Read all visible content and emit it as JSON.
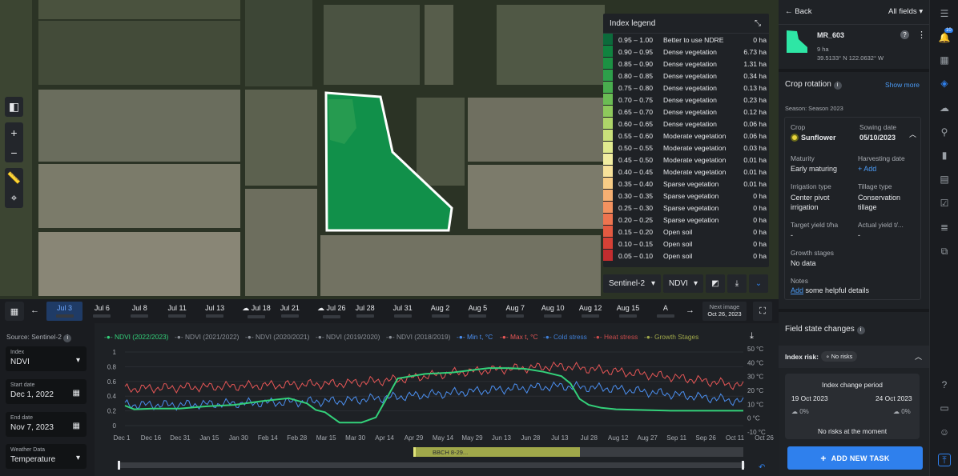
{
  "legend": {
    "title": "Index legend",
    "rows": [
      {
        "range": "0.95 – 1.00",
        "label": "Better to use NDRE",
        "area": "0 ha",
        "color": "#0c6b3b"
      },
      {
        "range": "0.90 – 0.95",
        "label": "Dense vegetation",
        "area": "6.73 ha",
        "color": "#10833f"
      },
      {
        "range": "0.85 – 0.90",
        "label": "Dense vegetation",
        "area": "1.31 ha",
        "color": "#1c9143"
      },
      {
        "range": "0.80 – 0.85",
        "label": "Dense vegetation",
        "area": "0.34 ha",
        "color": "#2d9f4a"
      },
      {
        "range": "0.75 – 0.80",
        "label": "Dense vegetation",
        "area": "0.13 ha",
        "color": "#49ad4e"
      },
      {
        "range": "0.70 – 0.75",
        "label": "Dense vegetation",
        "area": "0.23 ha",
        "color": "#6bbc54"
      },
      {
        "range": "0.65 – 0.70",
        "label": "Dense vegetation",
        "area": "0.12 ha",
        "color": "#8ec95c"
      },
      {
        "range": "0.60 – 0.65",
        "label": "Dense vegetation",
        "area": "0.06 ha",
        "color": "#aed569"
      },
      {
        "range": "0.55 – 0.60",
        "label": "Moderate vegetation",
        "area": "0.06 ha",
        "color": "#c9e07a"
      },
      {
        "range": "0.50 – 0.55",
        "label": "Moderate vegetation",
        "area": "0.03 ha",
        "color": "#e0ea8e"
      },
      {
        "range": "0.45 – 0.50",
        "label": "Moderate vegetation",
        "area": "0.01 ha",
        "color": "#f1eda0"
      },
      {
        "range": "0.40 – 0.45",
        "label": "Moderate vegetation",
        "area": "0.01 ha",
        "color": "#f7e29a"
      },
      {
        "range": "0.35 – 0.40",
        "label": "Sparse vegetation",
        "area": "0.01 ha",
        "color": "#f8cd86"
      },
      {
        "range": "0.30 – 0.35",
        "label": "Sparse vegetation",
        "area": "0 ha",
        "color": "#f6b072"
      },
      {
        "range": "0.25 – 0.30",
        "label": "Sparse vegetation",
        "area": "0 ha",
        "color": "#f3925f"
      },
      {
        "range": "0.20 – 0.25",
        "label": "Sparse vegetation",
        "area": "0 ha",
        "color": "#ee744f"
      },
      {
        "range": "0.15 – 0.20",
        "label": "Open soil",
        "area": "0 ha",
        "color": "#e45a41"
      },
      {
        "range": "0.10 – 0.15",
        "label": "Open soil",
        "area": "0 ha",
        "color": "#d64136"
      },
      {
        "range": "0.05 – 0.10",
        "label": "Open soil",
        "area": "0 ha",
        "color": "#c22d2f"
      }
    ]
  },
  "selectors": {
    "satellite": "Sentinel-2",
    "index": "NDVI"
  },
  "timeline": {
    "dates": [
      "Jul 3",
      "Jul 6",
      "Jul 8",
      "Jul 11",
      "Jul 13",
      "Jul 18",
      "Jul 21",
      "Jul 26",
      "Jul 28",
      "Jul 31",
      "Aug 2",
      "Aug 5",
      "Aug 7",
      "Aug 10",
      "Aug 12",
      "Aug 15",
      "A"
    ],
    "cloudy": [
      false,
      false,
      false,
      false,
      false,
      true,
      false,
      true,
      false,
      false,
      false,
      false,
      false,
      false,
      false,
      false,
      false
    ],
    "next_label": "Next image",
    "next_date": "Oct 26, 2023"
  },
  "left_panel": {
    "source": "Source: Sentinel-2",
    "index_label": "Index",
    "index_value": "NDVI",
    "start_label": "Start date",
    "start_value": "Dec 1, 2022",
    "end_label": "End date",
    "end_value": "Nov 7, 2023",
    "weather_label": "Weather Data",
    "weather_value": "Temperature"
  },
  "chart_data": {
    "type": "line",
    "legend": [
      {
        "name": "NDVI (2022/2023)",
        "color": "#33d17a"
      },
      {
        "name": "NDVI (2021/2022)",
        "color": "#8a8f96"
      },
      {
        "name": "NDVI (2020/2021)",
        "color": "#8a8f96"
      },
      {
        "name": "NDVI (2019/2020)",
        "color": "#8a8f96"
      },
      {
        "name": "NDVI (2018/2019)",
        "color": "#8a8f96"
      },
      {
        "name": "Min t, °C",
        "color": "#4b8ff0"
      },
      {
        "name": "Max t, °C",
        "color": "#e65656"
      },
      {
        "name": "Cold stress",
        "color": "#3f7fd6"
      },
      {
        "name": "Heat stress",
        "color": "#c94b4b"
      },
      {
        "name": "Growth Stages",
        "color": "#a0a84a"
      }
    ],
    "x_ticks": [
      "Dec 1",
      "Dec 16",
      "Dec 31",
      "Jan 15",
      "Jan 30",
      "Feb 14",
      "Feb 28",
      "Mar 15",
      "Mar 30",
      "Apr 14",
      "Apr 29",
      "May 14",
      "May 29",
      "Jun 13",
      "Jun 28",
      "Jul 13",
      "Jul 28",
      "Aug 12",
      "Aug 27",
      "Sep 11",
      "Sep 26",
      "Oct 11",
      "Oct 26"
    ],
    "y_left_ticks": [
      "1",
      "0.8",
      "0.6",
      "0.4",
      "0.2",
      "0"
    ],
    "y_right_ticks": [
      "50 °C",
      "40 °C",
      "30 °C",
      "20 °C",
      "10 °C",
      "0 °C",
      "-10 °C"
    ],
    "ylim": [
      0,
      1
    ],
    "y2lim": [
      -10,
      50
    ],
    "ndvi": {
      "x": [
        0,
        5,
        15,
        30,
        45,
        60,
        75,
        90,
        100,
        105,
        110,
        118,
        122,
        130,
        138,
        150,
        165,
        180,
        200,
        210,
        220,
        230,
        240,
        245,
        250,
        255,
        262,
        270,
        285,
        300,
        315,
        330,
        340
      ],
      "y": [
        0.25,
        0.2,
        0.21,
        0.21,
        0.24,
        0.26,
        0.31,
        0.35,
        0.28,
        0.19,
        0.16,
        0.02,
        0.02,
        0.02,
        0.09,
        0.62,
        0.68,
        0.7,
        0.76,
        0.76,
        0.75,
        0.71,
        0.65,
        0.55,
        0.34,
        0.26,
        0.22,
        0.2,
        0.19,
        0.18,
        0.18,
        0.18,
        0.18
      ]
    },
    "max_t": {
      "x": [
        0,
        30,
        60,
        90,
        120,
        150,
        180,
        210,
        240,
        270,
        300,
        330,
        340
      ],
      "y": [
        20,
        21,
        22,
        23,
        24,
        27,
        32,
        35,
        37,
        33,
        29,
        24,
        22
      ]
    },
    "min_t": {
      "x": [
        0,
        30,
        60,
        90,
        120,
        150,
        180,
        210,
        240,
        270,
        300,
        330,
        340
      ],
      "y": [
        8,
        8,
        9,
        10,
        11,
        14,
        17,
        20,
        22,
        20,
        16,
        12,
        10
      ]
    },
    "growth_label": "BBCH 8-29..."
  },
  "right": {
    "back": "Back",
    "all_fields": "All fields",
    "field_name": "MR_603",
    "field_area": "9 ha",
    "field_coords": "39.5133° N 122.0632° W",
    "crop_rotation": "Crop rotation",
    "show_more": "Show more",
    "season": "Season: Season 2023",
    "crop_label": "Crop",
    "crop_value": "Sunflower",
    "sowing_label": "Sowing date",
    "sowing_value": "05/10/2023",
    "maturity_label": "Maturity",
    "maturity_value": "Early maturing",
    "harvest_label": "Harvesting date",
    "harvest_value": "+ Add",
    "irrigation_label": "Irrigation type",
    "irrigation_value": "Center pivot irrigation",
    "tillage_label": "Tillage type",
    "tillage_value": "Conservation tillage",
    "target_label": "Target yield t/ha",
    "target_value": "-",
    "actual_label": "Actual yield t/...",
    "actual_value": "-",
    "growth_label": "Growth stages",
    "growth_value": "No data",
    "notes_label": "Notes",
    "notes_link": "Add",
    "notes_rest": " some helpful details",
    "field_state": "Field state changes",
    "index_risk": "Index risk:",
    "no_risks_badge": "No risks",
    "period_title": "Index change period",
    "period_from": "19 Oct 2023",
    "period_to": "24 Oct 2023",
    "cloud_from": "0%",
    "cloud_to": "0%",
    "no_risks_moment": "No risks at the moment",
    "add_task": "ADD NEW TASK",
    "notif_badge": "10"
  }
}
